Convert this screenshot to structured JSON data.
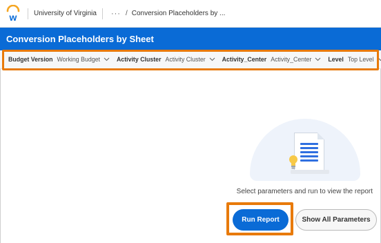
{
  "topbar": {
    "organization": "University of Virginia",
    "more": "···",
    "separator": "/",
    "breadcrumb": "Conversion Placeholders by ..."
  },
  "header": {
    "title": "Conversion Placeholders by Sheet",
    "color": "#0a6bd6"
  },
  "prompts": [
    {
      "label": "Budget Version",
      "value": "Working Budget"
    },
    {
      "label": "Activity Cluster",
      "value": "Activity Cluster"
    },
    {
      "label": "Activity_Center",
      "value": "Activity_Center"
    },
    {
      "label": "Level",
      "value": "Top Level"
    }
  ],
  "empty_state": {
    "message": "Select parameters and run to view the report"
  },
  "actions": {
    "run_label": "Run Report",
    "show_all_label": "Show All Parameters"
  },
  "colors": {
    "accent": "#0a6bd6",
    "highlight": "#e87a0a"
  },
  "icons": [
    "workday-logo-icon",
    "chevron-down-icon",
    "document-report-icon",
    "lightbulb-icon"
  ]
}
